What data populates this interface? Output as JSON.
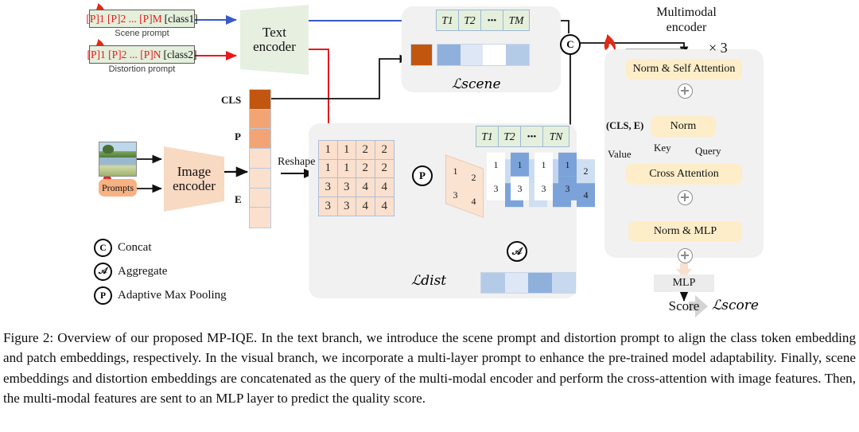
{
  "figure": {
    "number": "Figure 2",
    "caption": "Figure 2: Overview of our proposed MP-IQE. In the text branch, we introduce the scene prompt and distortion prompt to align the class token embedding and patch embeddings, respectively. In the visual branch, we incorporate a multi-layer prompt to enhance the pre-trained model adaptability. Finally, scene embeddings and distortion embeddings are concatenated as the query of the multi-modal encoder and perform the cross-attention with image features. Then, the multi-modal features are sent to an MLP layer to predict the quality score."
  },
  "text_branch": {
    "scene_prompt": {
      "tokens": "[P]1 [P]2 ... [P]M",
      "class": "[class1]",
      "label": "Scene prompt"
    },
    "distortion_prompt": {
      "tokens": "[P]1 [P]2 ... [P]N",
      "class": "[class2]",
      "label": "Distortion prompt"
    },
    "encoder_line1": "Text",
    "encoder_line2": "encoder",
    "frozen_icon": "snowflake-icon",
    "fire_icon": "flame-icon"
  },
  "visual_branch": {
    "image_thumbnail": "scenery-thumbnail",
    "prompts_label": "Prompts",
    "encoder_line1": "Image",
    "encoder_line2": "encoder",
    "reshape_label": "Reshape",
    "feature_labels": {
      "cls": "CLS",
      "p": "P",
      "e": "E"
    },
    "feature_colors": [
      "#c2560f",
      "#f2a474",
      "#f2a474",
      "#fbe0cd",
      "#fbe0cd",
      "#fbe0cd",
      "#fbe0cd"
    ],
    "matrix": [
      [
        1,
        1,
        2,
        2
      ],
      [
        1,
        1,
        2,
        2
      ],
      [
        3,
        3,
        4,
        4
      ],
      [
        3,
        3,
        4,
        4
      ]
    ],
    "pooled_patch": [
      1,
      2,
      3,
      4
    ],
    "patch_cards": [
      {
        "values": [
          1,
          2,
          3,
          4
        ],
        "colors": [
          "#fbe3d2",
          "#fbe3d2",
          "#fbe3d2",
          "#fbe3d2"
        ]
      },
      {
        "values": [
          1,
          2,
          3,
          4
        ],
        "colors": [
          "#ffffff",
          "#ccdcf0",
          "#ffffff",
          "#7ba3d9"
        ]
      },
      {
        "values": [
          1,
          2,
          3,
          4
        ],
        "colors": [
          "#7ba3d9",
          "#ccdcf0",
          "#ffffff",
          "#cfdff2"
        ]
      },
      {
        "values": [
          1,
          2,
          3,
          4
        ],
        "colors": [
          "#ffffff",
          "#c3d5ee",
          "#ffffff",
          "#7ba3d9"
        ]
      },
      {
        "values": [
          1,
          2,
          3,
          4
        ],
        "colors": [
          "#7ba3d9",
          "#cfdff2",
          "#7ba3d9",
          "#7ba3d9"
        ]
      }
    ]
  },
  "tokens": {
    "scene_row": [
      "T1",
      "T2",
      "•••",
      "TM"
    ],
    "dist_row": [
      "T1",
      "T2",
      "•••",
      "TN"
    ],
    "scene_heat_cls": "#c2560f",
    "scene_heat": [
      "#8fb0da",
      "#dde7f6",
      "#ffffff",
      "#b4cbe8"
    ],
    "dist_heat": [
      "#b4cbe8",
      "#dde7f6",
      "#8fb0da",
      "#c7d8ef"
    ]
  },
  "losses": {
    "scene": "ℒscene",
    "dist": "ℒdist",
    "score": "ℒscore"
  },
  "multimodal_encoder": {
    "title_line1": "Multimodal",
    "title_line2": "encoder",
    "repeat": "× 3",
    "blocks": {
      "self_attention": "Norm & Self Attention",
      "norm": "Norm",
      "cross_attention": "Cross Attention",
      "norm_mlp": "Norm & MLP",
      "mlp": "MLP"
    },
    "kv_source": "(CLS, E)",
    "value_label": "Value",
    "key_label": "Key",
    "query_label": "Query",
    "score_label": "Score"
  },
  "legend": [
    {
      "symbol": "C",
      "name": "concat-icon",
      "label": "Concat"
    },
    {
      "symbol": "𝒜",
      "name": "aggregate-icon",
      "label": "Aggregate"
    },
    {
      "symbol": "P",
      "name": "adaptive-max-pooling-icon",
      "label": "Adaptive Max Pooling"
    }
  ],
  "concat_node": {
    "symbol": "C",
    "name": "concat-node"
  },
  "colors": {
    "text_encoder": "#e7efe1",
    "image_encoder": "#f8d9c2",
    "attention_block": "#fdeec9",
    "panel": "#f1f1f1",
    "scene_arrow": "#3a59c8",
    "dist_arrow": "#e8191b",
    "cls_orange": "#c2560f"
  }
}
